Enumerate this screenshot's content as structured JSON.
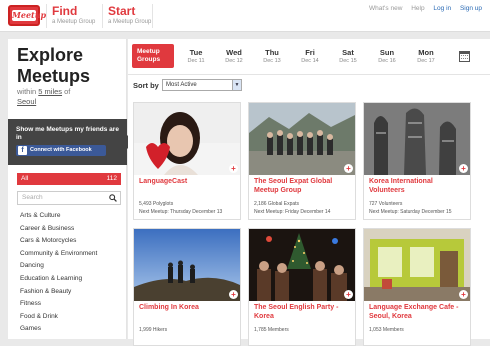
{
  "topbar": {
    "logo_text": "Meetup",
    "find": {
      "title": "Find",
      "subtitle": "a Meetup Group"
    },
    "start": {
      "title": "Start",
      "subtitle": "a Meetup Group"
    },
    "links": {
      "whats_new": "What's new",
      "help": "Help",
      "login": "Log in",
      "signup": "Sign up"
    }
  },
  "sidebar": {
    "heading_line1": "Explore",
    "heading_line2": "Meetups",
    "within_prefix": "within",
    "within_distance": "5 miles",
    "within_of": "of",
    "location": "Seoul",
    "friends_text": "Show me Meetups my friends are in",
    "facebook_label": "Connect with Facebook",
    "all_label": "All",
    "all_count": "112",
    "search_placeholder": "Search",
    "categories": [
      "Arts & Culture",
      "Career & Business",
      "Cars & Motorcycles",
      "Community & Environment",
      "Dancing",
      "Education & Learning",
      "Fashion & Beauty",
      "Fitness",
      "Food & Drink",
      "Games"
    ]
  },
  "header": {
    "groups_label_1": "Meetup",
    "groups_label_2": "Groups",
    "days": [
      {
        "day": "Tue",
        "date": "Dec 11"
      },
      {
        "day": "Wed",
        "date": "Dec 12"
      },
      {
        "day": "Thu",
        "date": "Dec 13"
      },
      {
        "day": "Fri",
        "date": "Dec 14"
      },
      {
        "day": "Sat",
        "date": "Dec 15"
      },
      {
        "day": "Sun",
        "date": "Dec 16"
      },
      {
        "day": "Mon",
        "date": "Dec 17"
      }
    ],
    "sort_label": "Sort by",
    "sort_value": "Most Active"
  },
  "groups": [
    {
      "name": "LanguageCast",
      "members": "5,493 Polyglots",
      "next": "Next Meetup: Thursday December 13"
    },
    {
      "name": "The Seoul Expat Global Meetup Group",
      "members": "2,186 Global Expats",
      "next": "Next Meetup: Friday December 14"
    },
    {
      "name": "Korea International Volunteers",
      "members": "727 Volunteers",
      "next": "Next Meetup: Saturday December 15"
    },
    {
      "name": "Climbing In Korea",
      "members": "1,999 Hikers",
      "next": ""
    },
    {
      "name": "The Seoul English Party - Korea",
      "members": "1,785 Members",
      "next": ""
    },
    {
      "name": "Language Exchange Cafe - Seoul, Korea",
      "members": "1,053 Members",
      "next": ""
    }
  ]
}
